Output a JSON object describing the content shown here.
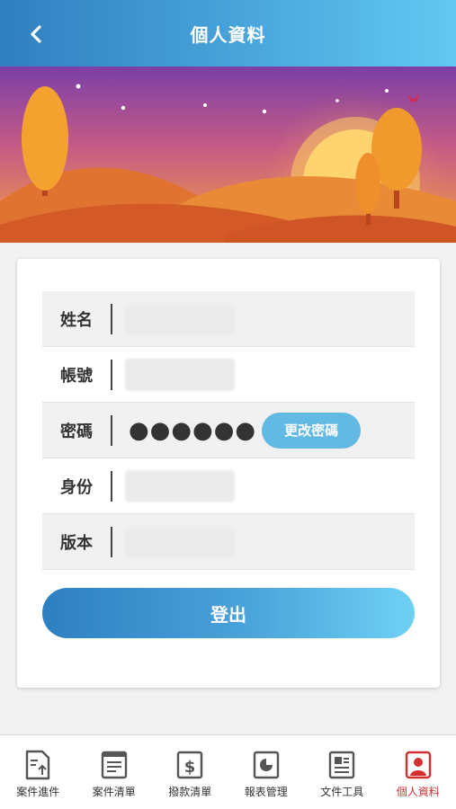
{
  "header": {
    "title": "個人資料"
  },
  "profile": {
    "rows": [
      {
        "label": "姓名"
      },
      {
        "label": "帳號"
      },
      {
        "label": "密碼",
        "value": "●●●●●●"
      },
      {
        "label": "身份"
      },
      {
        "label": "版本"
      }
    ],
    "change_password_label": "更改密碼"
  },
  "logout_label": "登出",
  "tabs": [
    {
      "label": "案件進件",
      "icon": "file-upload-icon"
    },
    {
      "label": "案件清單",
      "icon": "list-icon"
    },
    {
      "label": "撥款清單",
      "icon": "dollar-icon"
    },
    {
      "label": "報表管理",
      "icon": "pie-chart-icon"
    },
    {
      "label": "文件工具",
      "icon": "document-icon"
    },
    {
      "label": "個人資料",
      "icon": "user-icon",
      "active": true
    }
  ],
  "colors": {
    "accent": "#4aa6dc",
    "active_tab": "#d32f2f",
    "change_button": "#62b9e3"
  }
}
